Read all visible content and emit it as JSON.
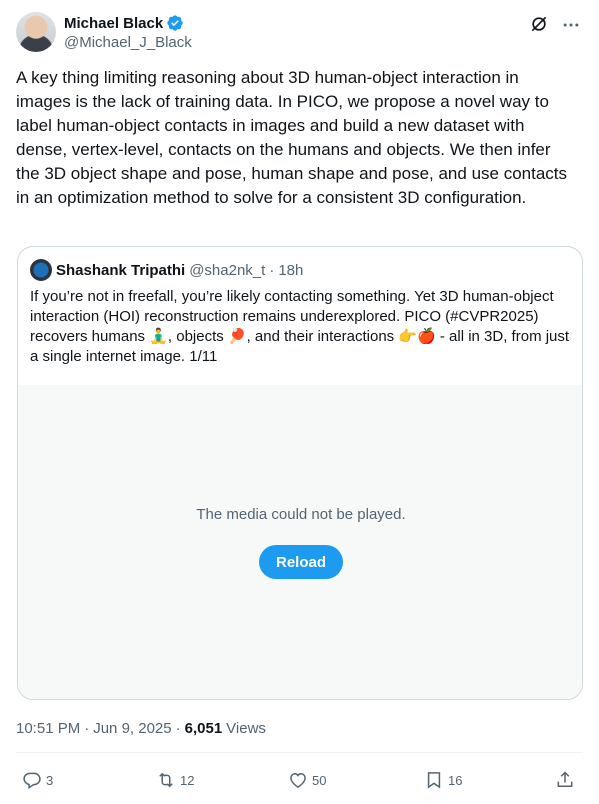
{
  "author": {
    "name": "Michael Black",
    "handle": "@Michael_J_Black",
    "verified": true
  },
  "tweet": {
    "text": "A key thing limiting reasoning about 3D human-object interaction in images is the lack of training data. In PICO, we propose a novel way to label human-object contacts in images and build a new dataset with dense, vertex-level, contacts on the humans and objects. We then infer the 3D object shape and pose, human shape and pose, and use contacts in an optimization method to solve for a consistent 3D configuration."
  },
  "quote": {
    "name": "Shashank Tripathi",
    "handle": "@sha2nk_t",
    "separator": "·",
    "time": "18h",
    "text": "If you’re not in freefall, you’re likely contacting something. Yet 3D human-object interaction (HOI) reconstruction remains underexplored. PICO (#CVPR2025) recovers humans 🧘‍♂️, objects 🏓, and their interactions 👉🍎 - all in 3D, from just a single internet image. 1/11",
    "media": {
      "message": "The media could not be played.",
      "reload_label": "Reload"
    }
  },
  "meta": {
    "time": "10:51 PM",
    "date": "Jun 9, 2025",
    "views_count": "6,051",
    "views_label": "Views",
    "sep1": "·",
    "sep2": "·"
  },
  "actions": {
    "replies": "3",
    "reposts": "12",
    "likes": "50",
    "bookmarks": "16"
  },
  "colors": {
    "accent": "#1d9bf0",
    "secondary_text": "#536471",
    "border": "#cfd9de"
  },
  "icons": [
    "verified-badge-icon",
    "grok-icon",
    "more-icon",
    "reply-icon",
    "repost-icon",
    "like-icon",
    "bookmark-icon",
    "share-icon"
  ]
}
